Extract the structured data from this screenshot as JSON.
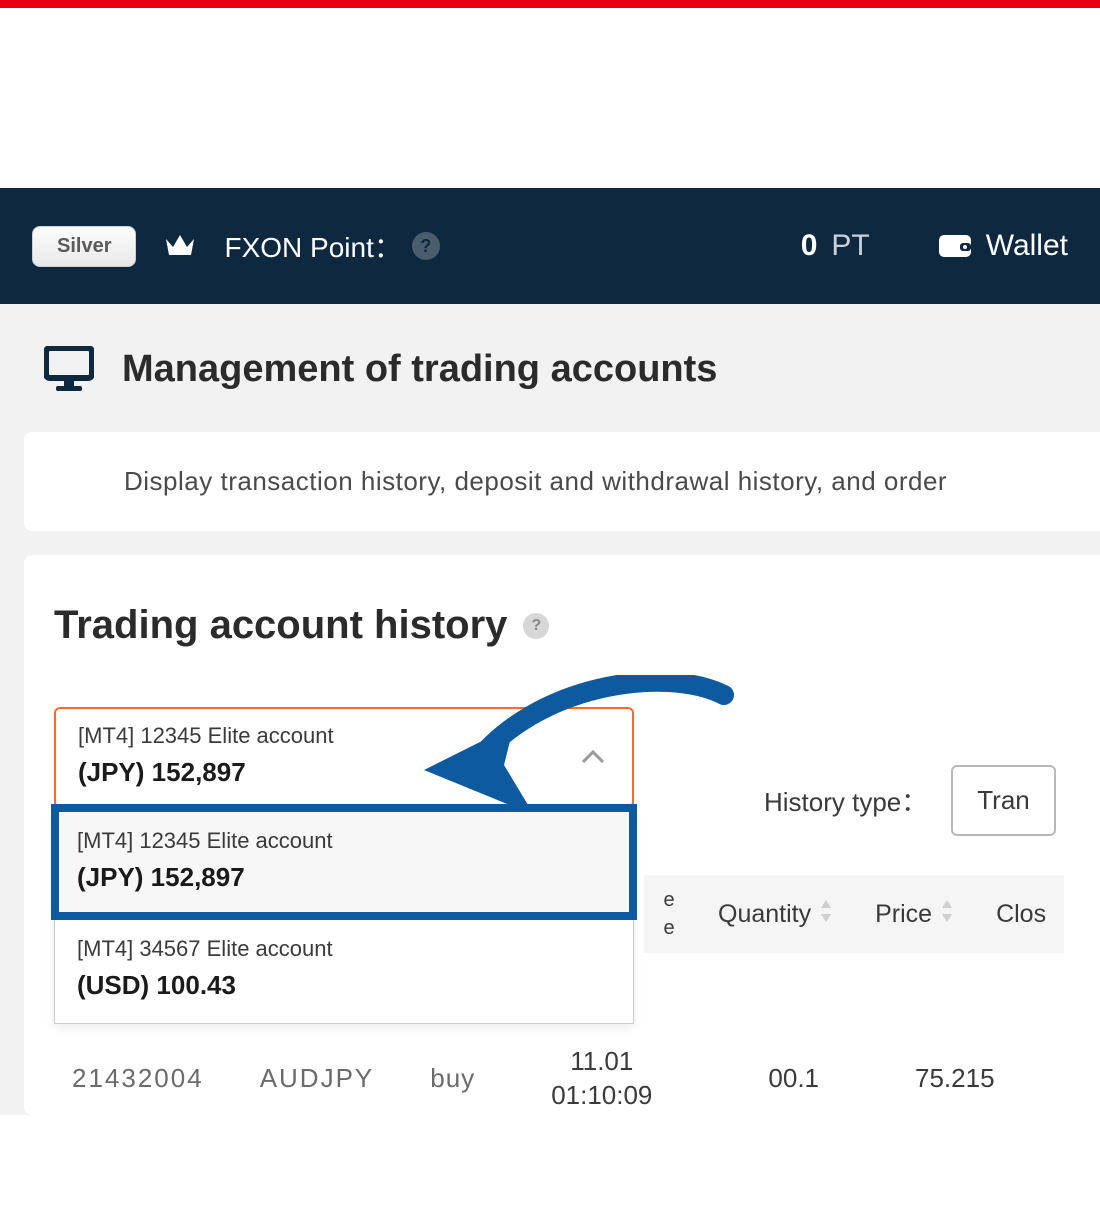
{
  "topbar": {
    "tier_badge": "Silver",
    "point_label": "FXON Point：",
    "points_value": "0",
    "points_unit": "PT",
    "wallet_label": "Wallet"
  },
  "page": {
    "title": "Management of trading accounts",
    "description": "Display transaction history, deposit and withdrawal history, and order"
  },
  "history": {
    "section_title": "Trading account history",
    "selected": {
      "line1": "[MT4] 12345 Elite account",
      "line2": "(JPY) 152,897"
    },
    "options": [
      {
        "line1": "[MT4] 12345 Elite account",
        "line2": "(JPY) 152,897"
      },
      {
        "line1": "[MT4] 34567 Elite account",
        "line2": "(USD) 100.43"
      }
    ],
    "type_label": "History type：",
    "type_value": "Tran"
  },
  "table": {
    "headers": {
      "e_top": "e",
      "e_bot": "e",
      "qty": "Quantity",
      "price": "Price",
      "close": "Clos"
    },
    "row": {
      "order": "21432004",
      "symbol": "AUDJPY",
      "type": "buy",
      "date": "11.01",
      "time": "01:10:09",
      "qty": "00.1",
      "price": "75.215"
    }
  }
}
